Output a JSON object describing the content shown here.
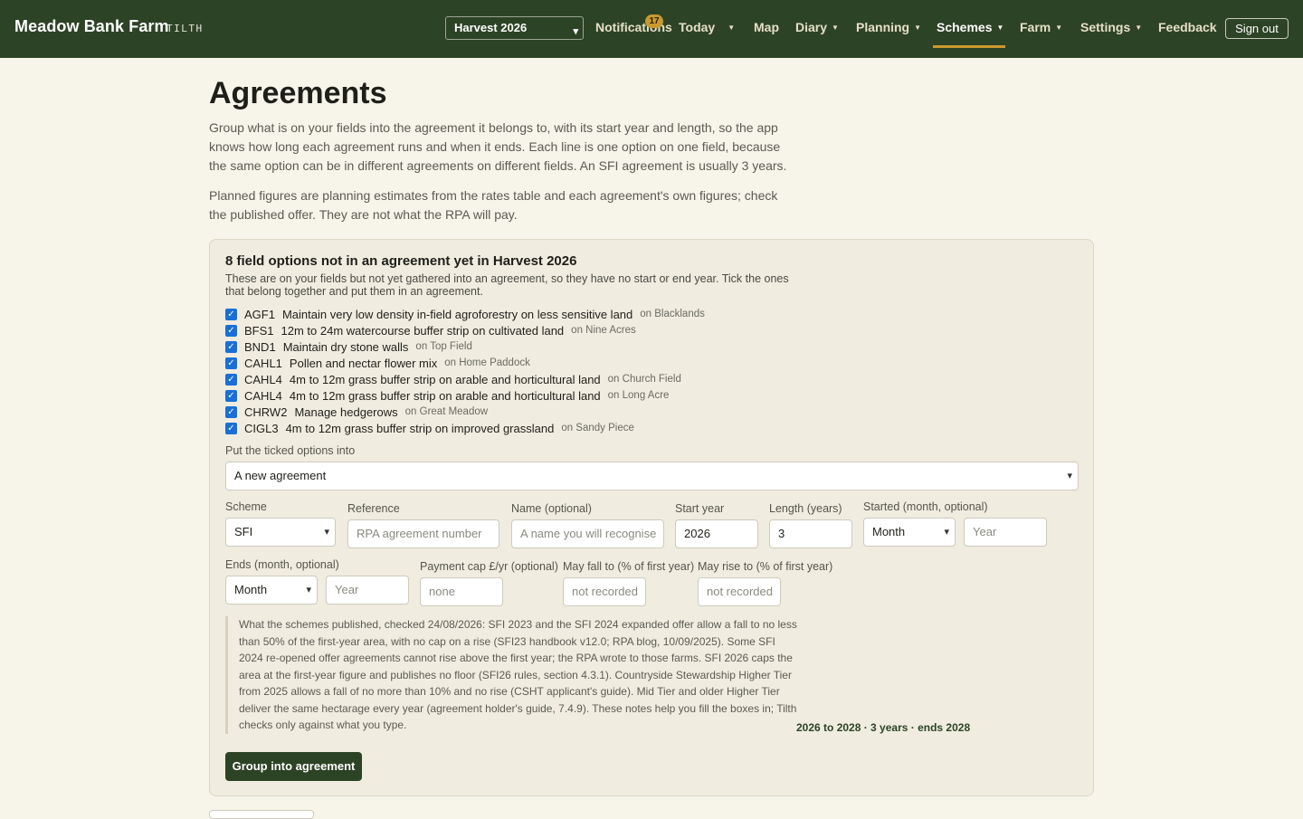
{
  "nav": {
    "brand": "Meadow Bank Farm",
    "brand_tag": "TILTH",
    "harvest_select": "Harvest 2026",
    "notifications": "Notifications",
    "notification_count": "17",
    "items": {
      "today": "Today",
      "map": "Map",
      "diary": "Diary",
      "planning": "Planning",
      "schemes": "Schemes",
      "farm": "Farm",
      "settings": "Settings",
      "feedback": "Feedback"
    },
    "signout": "Sign out"
  },
  "page": {
    "title": "Agreements",
    "intro_1": "Group what is on your fields into the agreement it belongs to, with its start year and length, so the app knows how long each agreement runs and when it ends. Each line is one option on one field, because the same option can be in different agreements on different fields. An SFI agreement is usually 3 years.",
    "intro_2": "Planned figures are planning estimates from the rates table and each agreement's own figures; check the published offer. They are not what the RPA will pay."
  },
  "panel": {
    "title": "8 field options not in an agreement yet in Harvest 2026",
    "subtitle": "These are on your fields but not yet gathered into an agreement, so they have no start or end year. Tick the ones that belong together and put them in an agreement.",
    "options": [
      {
        "code": "AGF1",
        "title": "Maintain very low density in-field agroforestry on less sensitive land",
        "field": "on Blacklands"
      },
      {
        "code": "BFS1",
        "title": "12m to 24m watercourse buffer strip on cultivated land",
        "field": "on Nine Acres"
      },
      {
        "code": "BND1",
        "title": "Maintain dry stone walls",
        "field": "on Top Field"
      },
      {
        "code": "CAHL1",
        "title": "Pollen and nectar flower mix",
        "field": "on Home Paddock"
      },
      {
        "code": "CAHL4",
        "title": "4m to 12m grass buffer strip on arable and horticultural land",
        "field": "on Church Field"
      },
      {
        "code": "CAHL4",
        "title": "4m to 12m grass buffer strip on arable and horticultural land",
        "field": "on Long Acre"
      },
      {
        "code": "CHRW2",
        "title": "Manage hedgerows",
        "field": "on Great Meadow"
      },
      {
        "code": "CIGL3",
        "title": "4m to 12m grass buffer strip on improved grassland",
        "field": "on Sandy Piece"
      }
    ],
    "into_label": "Put the ticked options into",
    "into_value": "A new agreement",
    "form": {
      "scheme_label": "Scheme",
      "scheme_value": "SFI",
      "reference_label": "Reference",
      "reference_placeholder": "RPA agreement number",
      "name_label": "Name (optional)",
      "name_placeholder": "A name you will recognise",
      "start_label": "Start year",
      "start_value": "2026",
      "length_label": "Length (years)",
      "length_value": "3",
      "started_label": "Started (month, optional)",
      "started_month": "Month",
      "started_year_placeholder": "Year",
      "ends_label": "Ends (month, optional)",
      "ends_month": "Month",
      "ends_year_placeholder": "Year",
      "cap_label": "Payment cap £/yr (optional)",
      "cap_placeholder": "none",
      "fall_label": "May fall to (% of first year)",
      "fall_placeholder": "not recorded",
      "rise_label": "May rise to (% of first year)",
      "rise_placeholder": "not recorded"
    },
    "note": "What the schemes published, checked 24/08/2026: SFI 2023 and the SFI 2024 expanded offer allow a fall to no less than 50% of the first-year area, with no cap on a rise (SFI23 handbook v12.0; RPA blog, 10/09/2025). Some SFI 2024 re-opened offer agreements cannot rise above the first year; the RPA wrote to those farms. SFI 2026 caps the area at the first-year figure and publishes no floor (SFI26 rules, section 4.3.1). Countryside Stewardship Higher Tier from 2025 allows a fall of no more than 10% and no rise (CSHT applicant's guide). Mid Tier and older Higher Tier deliver the same hectarage every year (agreement holder's guide, 7.4.9). These notes help you fill the boxes in; Tilth checks only against what you type.",
    "summary": "2026 to 2028 · 3 years · ends 2028",
    "submit": "Group into agreement"
  }
}
